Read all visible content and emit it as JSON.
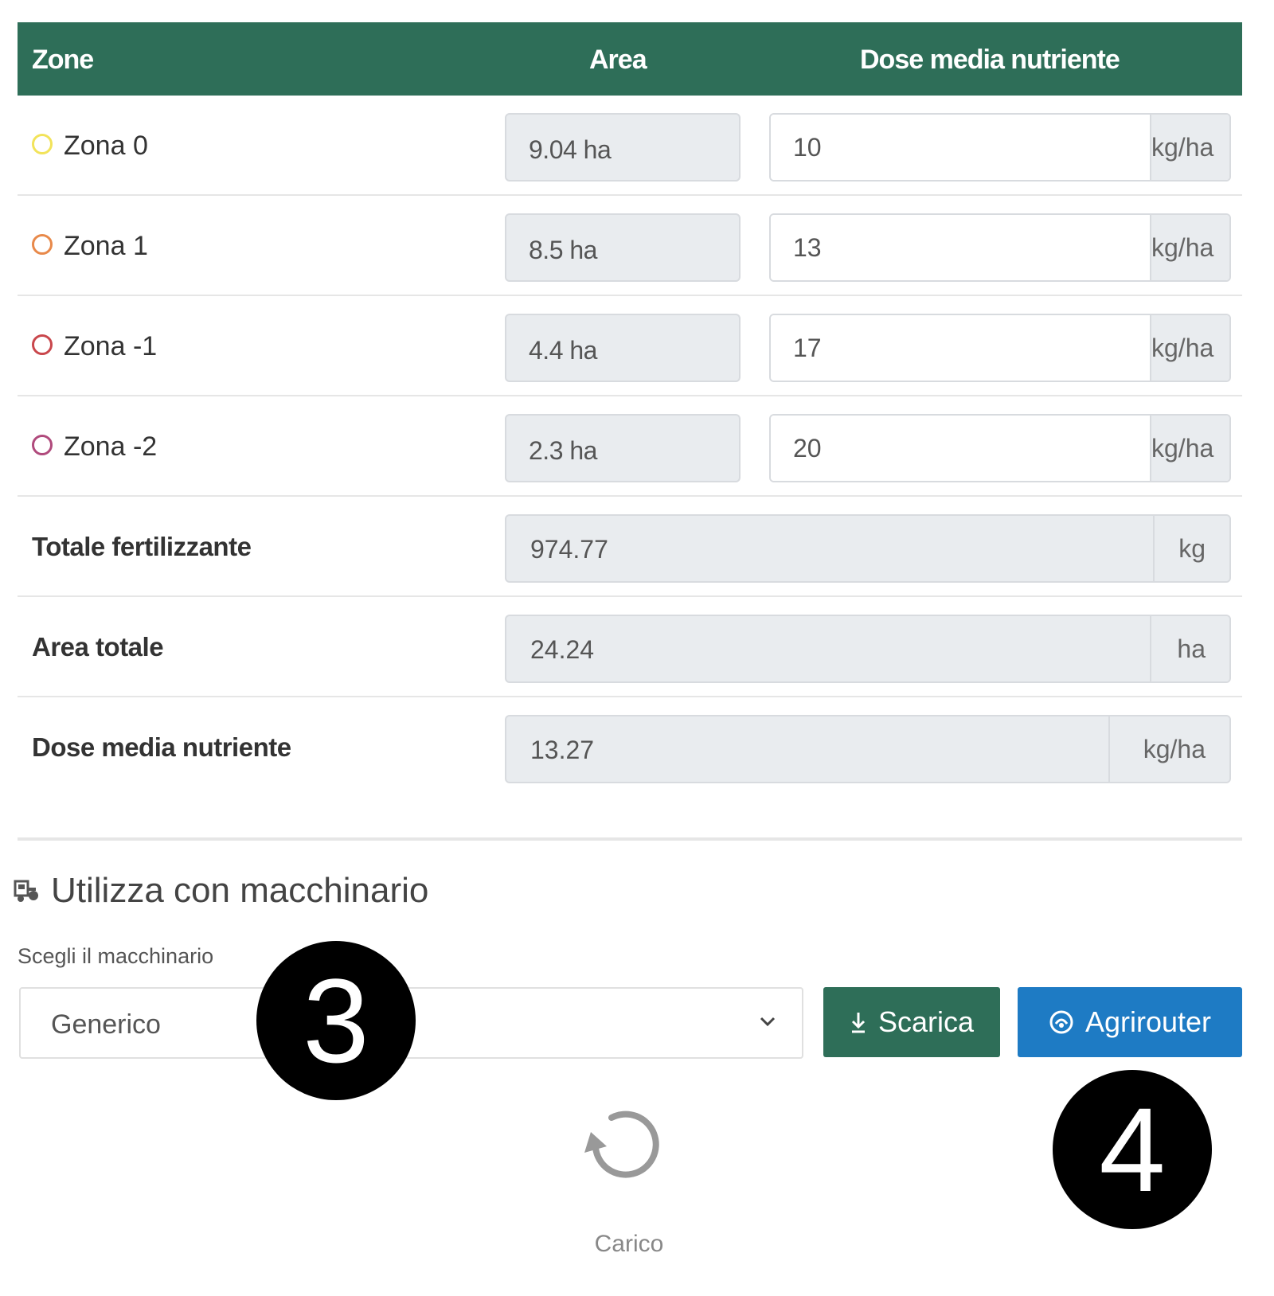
{
  "table": {
    "headers": {
      "zone": "Zone",
      "area": "Area",
      "dose": "Dose media nutriente"
    },
    "zones": [
      {
        "label": "Zona 0",
        "area": "9.04 ha",
        "dose": "10",
        "unit": "kg/ha",
        "color": "#f2e35a"
      },
      {
        "label": "Zona 1",
        "area": "8.5 ha",
        "dose": "13",
        "unit": "kg/ha",
        "color": "#e8894a"
      },
      {
        "label": "Zona -1",
        "area": "4.4 ha",
        "dose": "17",
        "unit": "kg/ha",
        "color": "#c9474c"
      },
      {
        "label": "Zona -2",
        "area": "2.3 ha",
        "dose": "20",
        "unit": "kg/ha",
        "color": "#b04a7c"
      }
    ],
    "summary": [
      {
        "label": "Totale fertilizzante",
        "value": "974.77",
        "unit": "kg"
      },
      {
        "label": "Area totale",
        "value": "24.24",
        "unit": "ha"
      },
      {
        "label": "Dose media nutriente",
        "value": "13.27",
        "unit": "kg/ha"
      }
    ]
  },
  "machinery": {
    "title": "Utilizza con macchinario",
    "icon": "tractor-icon",
    "select_label": "Scegli il macchinario",
    "selected": "Generico",
    "download_button": "Scarica",
    "download_icon": "download-icon",
    "agrirouter_button": "Agrirouter",
    "agrirouter_icon": "agrirouter-icon"
  },
  "annotations": {
    "step3": "3",
    "step4": "4"
  },
  "loading": {
    "text": "Carico",
    "icon": "reload-icon"
  },
  "colors": {
    "header_green": "#2e6e58",
    "button_green": "#2e6e58",
    "button_blue": "#1e7bc4"
  }
}
